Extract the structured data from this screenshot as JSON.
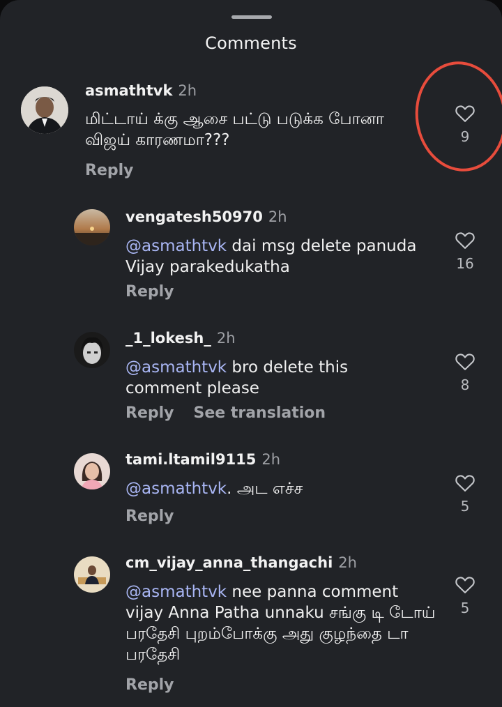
{
  "header": {
    "title": "Comments"
  },
  "comments": [
    {
      "username": "asmathtvk",
      "time": "2h",
      "mention": "",
      "text": "மிட்டாய் க்கு ஆசை பட்டு படுக்க போனா விஜய் காரணமா???",
      "reply_label": "Reply",
      "likes": "9"
    },
    {
      "username": "vengatesh50970",
      "time": "2h",
      "mention": "@asmathtvk",
      "text": " dai msg delete panuda Vijay parakedukatha",
      "reply_label": "Reply",
      "likes": "16"
    },
    {
      "username": "_1_lokesh_",
      "time": "2h",
      "mention": "@asmathtvk",
      "text": " bro delete this comment please",
      "reply_label": "Reply",
      "translate_label": "See translation",
      "likes": "8"
    },
    {
      "username": "tami.ltamil9115",
      "time": "2h",
      "mention": "@asmathtvk",
      "text": ".  அட எச்ச",
      "reply_label": "Reply",
      "likes": "5"
    },
    {
      "username": "cm_vijay_anna_thangachi",
      "time": "2h",
      "mention": "@asmathtvk",
      "text": " nee panna comment vijay Anna Patha unnaku சங்கு டி டோய் பரதேசி புறம்போக்கு அது குழந்தை டா பரதேசி",
      "reply_label": "Reply",
      "likes": "5"
    }
  ],
  "colors": {
    "mention": "#a9b6f4",
    "highlight_circle": "#e74c3c",
    "background": "#212327"
  }
}
